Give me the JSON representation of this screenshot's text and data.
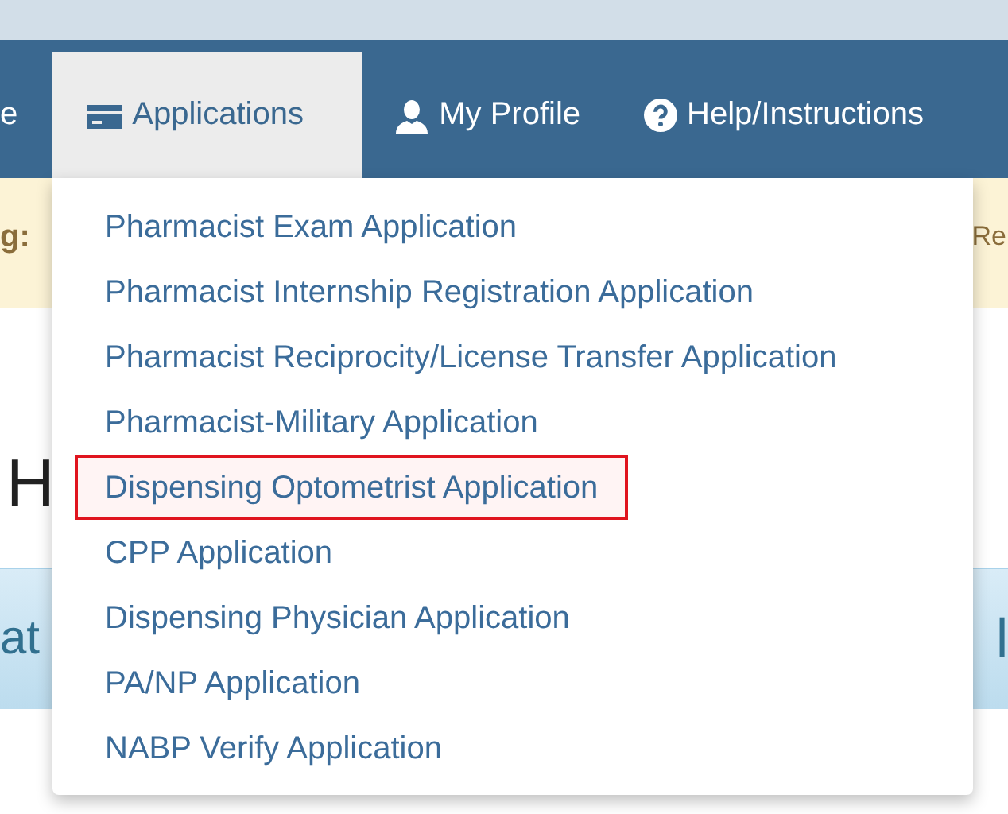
{
  "nav": {
    "cut_label": "e",
    "tabs": [
      {
        "label": "Applications",
        "kind": "card",
        "selected": true
      },
      {
        "label": "My Profile",
        "kind": "user",
        "selected": false
      },
      {
        "label": "Help/Instructions",
        "kind": "help",
        "selected": false
      }
    ]
  },
  "alert": {
    "left_text": "g:",
    "right_text": "Re"
  },
  "heading": "H",
  "info_band": {
    "left_text": "at",
    "right_text": "l"
  },
  "menu": {
    "items": [
      {
        "label": "Pharmacist Exam Application",
        "highlighted": false
      },
      {
        "label": "Pharmacist Internship Registration Application",
        "highlighted": false
      },
      {
        "label": "Pharmacist Reciprocity/License Transfer Application",
        "highlighted": false
      },
      {
        "label": "Pharmacist-Military Application",
        "highlighted": false
      },
      {
        "label": "Dispensing Optometrist Application",
        "highlighted": true
      },
      {
        "label": "CPP Application",
        "highlighted": false
      },
      {
        "label": "Dispensing Physician Application",
        "highlighted": false
      },
      {
        "label": "PA/NP Application",
        "highlighted": false
      },
      {
        "label": "NABP Verify Application",
        "highlighted": false
      }
    ]
  }
}
